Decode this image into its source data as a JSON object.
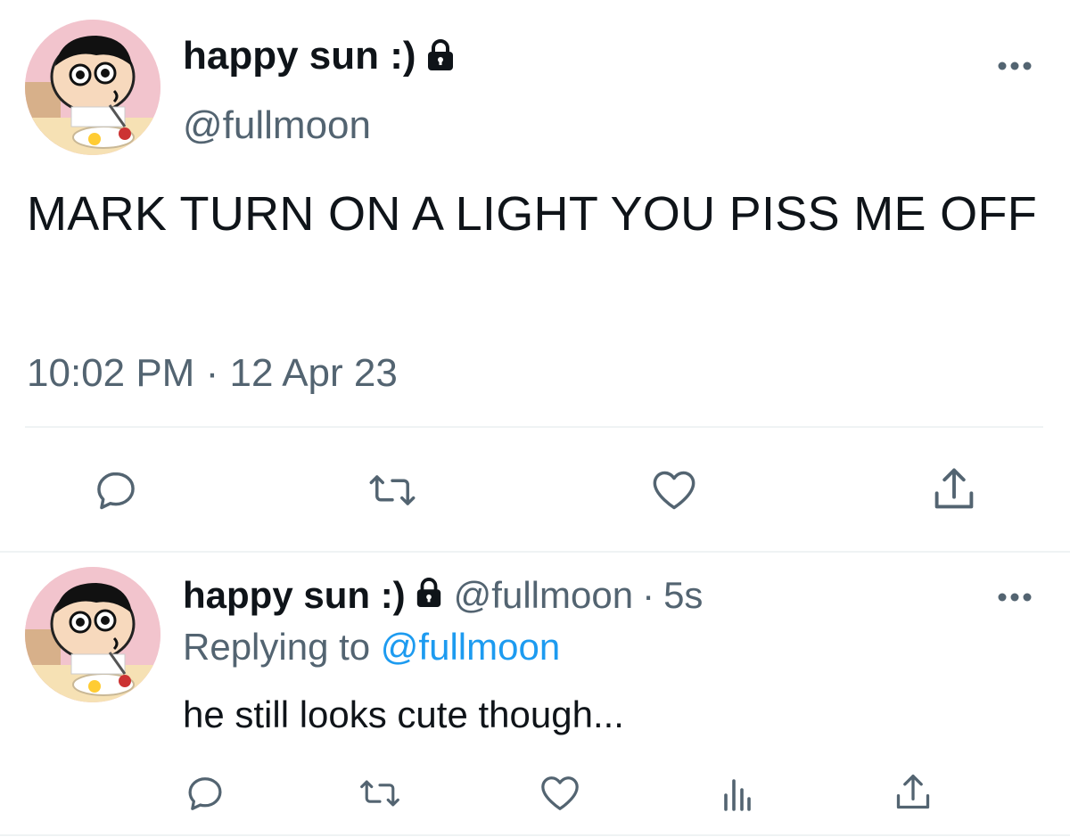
{
  "main_tweet": {
    "display_name": "happy sun :)",
    "handle": "@fullmoon",
    "text": "MARK TURN ON A LIGHT YOU PISS ME OFF",
    "time": "10:02 PM",
    "separator": "·",
    "date": "12 Apr 23"
  },
  "reply_tweet": {
    "display_name": "happy sun :)",
    "handle": "@fullmoon",
    "separator": "·",
    "age": "5s",
    "replying_prefix": "Replying to",
    "replying_to": "@fullmoon",
    "text": "he still looks cute though..."
  },
  "icons": {
    "verified_lock": "lock-icon",
    "more": "more-icon",
    "reply": "reply-icon",
    "retweet": "retweet-icon",
    "like": "heart-icon",
    "analytics": "analytics-icon",
    "share": "share-icon"
  },
  "colors": {
    "text": "#0f1419",
    "secondary": "#536471",
    "link": "#1d9bf0",
    "divider": "#eff3f4"
  }
}
